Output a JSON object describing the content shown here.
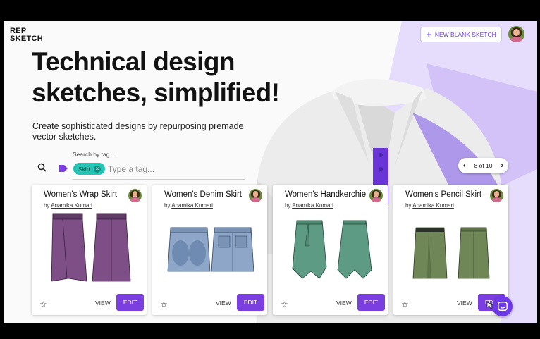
{
  "brand": {
    "logo_line1": "REP",
    "logo_line2": "SKETCH"
  },
  "header": {
    "new_sketch_label": "NEW BLANK SKETCH"
  },
  "hero": {
    "title_line1": "Technical design",
    "title_line2": "sketches, simplified!",
    "subtitle": "Create sophisticated designs by repurposing premade vector sketches."
  },
  "search": {
    "label": "Search by tag...",
    "chip": "Skirt",
    "placeholder": "Type a tag..."
  },
  "pager": {
    "text": "8 of 10"
  },
  "cards": [
    {
      "title": "Women's Wrap Skirt",
      "by": "by",
      "author": "Anamika Kumari",
      "view": "VIEW",
      "edit": "EDIT",
      "color": "#7e4f86"
    },
    {
      "title": "Women's Denim Skirt",
      "by": "by",
      "author": "Anamika Kumari",
      "view": "VIEW",
      "edit": "EDIT",
      "color": "#8ea6c7"
    },
    {
      "title": "Women's Handkerchief Skirt",
      "by": "by",
      "author": "Anamika Kumari",
      "view": "VIEW",
      "edit": "EDIT",
      "color": "#5e9b84"
    },
    {
      "title": "Women's Pencil Skirt",
      "by": "by",
      "author": "Anamika Kumari",
      "view": "VIEW",
      "edit": "EDIT",
      "color": "#6f8757"
    }
  ],
  "colors": {
    "accent": "#7b3fe0",
    "tag_chip": "#25c4b4",
    "lavender": "#d8ccfb"
  }
}
